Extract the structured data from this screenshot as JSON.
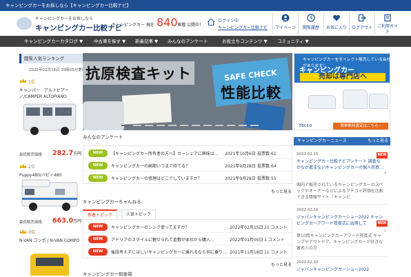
{
  "topbar": {
    "text": "キャンピングカーをお探しなら【キャンピングカー比較ナビ】"
  },
  "header": {
    "tagline": "キャンピングカーをお探しなら",
    "site_name": "キャンピングカー比較ナビ",
    "count_prefix": "キャンピングカー 現在",
    "count_number": "840",
    "count_suffix": "車種 公開中！",
    "login_line1": "ログイン中",
    "login_line2": "キャンピングカー比較ナビ",
    "buttons": [
      {
        "label": "マイページ",
        "icon": "user-icon"
      },
      {
        "label": "閲覧履歴",
        "icon": "clock-icon"
      },
      {
        "label": "お気に入り",
        "icon": "heart-icon"
      },
      {
        "label": "ログアウト",
        "icon": "logout-icon"
      },
      {
        "label": "ご利用ガイド",
        "icon": "book-icon"
      }
    ]
  },
  "nav": {
    "items": [
      "キャンピングカーカタログ ▼",
      "中古車を探す ▼",
      "新着記事 ▼",
      "みんなのアンケート",
      "お役立ちコンテンツ ▼",
      "コミュニティ ▼"
    ]
  },
  "ranking": {
    "title": "閲覧人気ランキング",
    "updated": "2022年02月18日 20時05分更新",
    "items": [
      {
        "rank": "1位",
        "name": "キャンパー　アルトピアーノ/CAMPER ALTOPIANO",
        "label_min": "最低販売価格",
        "price": "282.7",
        "unit": "万円"
      },
      {
        "rank": "2位",
        "name": "Puppy480/パピィ480",
        "label_min": "最低販売価格",
        "price": "663.0",
        "unit": "万円"
      },
      {
        "rank": "3位",
        "name": "N-VAN コンポ / N-VAN COMPO",
        "label_min": "",
        "price": "",
        "unit": ""
      }
    ]
  },
  "hero": {
    "title": "抗原検査キット",
    "subtitle": "性能比較",
    "box_text": "SAFE CHECK"
  },
  "survey": {
    "title": "みんなのアンケート",
    "rows": [
      {
        "badge": "NEW",
        "text": "【キャンピングカー所有者の方へ】カーシェアに興味は…",
        "date": "2021年10月6日",
        "votes": "投票数:61"
      },
      {
        "badge": "NEW",
        "text": "キャンピングカーの納期いつまで待てる？",
        "date": "2021年9月28日",
        "votes": "投票数:64"
      },
      {
        "badge": "NEW",
        "text": "キャンピングカーの修理はどこでしていますか？",
        "date": "2021年9月28日",
        "votes": "投票数:55"
      }
    ],
    "more": "もっと見る"
  },
  "channel": {
    "title": "キャンピングカーちゃんねる",
    "tabs": [
      "新着トピック",
      "人気トピック"
    ],
    "rows": [
      {
        "badge": "NEW",
        "text": "キャンピングカーのシンク使ってますか？",
        "date": "2022年02月15日",
        "comments": "21 コメント"
      },
      {
        "badge": "NEW",
        "text": "アドリアのスタイルに魅せられて倉敷が本社から購入…",
        "date": "2022年01月05日",
        "comments": "1 コメント"
      },
      {
        "badge": "NEW",
        "text": "後段考えずにほしいキャンピングカーに乗れるなら何に乗り…",
        "date": "2021年11月18日",
        "comments": "11 コメント"
      }
    ],
    "more": "もっと見る"
  },
  "knowledge": {
    "title": "キャンピングカー知恵袋"
  },
  "ad": {
    "line1": "キャンピングカーをダイレクト販売",
    "line1b": "している会社があります！",
    "line2": "キャンピングカー",
    "line3": "売却は専門店へ",
    "logo": "Yacco",
    "button": "簡単無料査定はこちら ›"
  },
  "news": {
    "title": "キャンピングカーニュース",
    "more": "もっと見る",
    "items": [
      {
        "date": "2022.02.15",
        "text": "キャンピングカー比較ナビアンケート 調査なかなか進まないキャンピングカーの個人売買…",
        "new": "NEW",
        "desc": "国内で販売されているキャンピングカーのスペックやオーナーなどによるクチコミ評価を比較できる情報サイト「キャンピ"
      },
      {
        "date": "2022.02.10",
        "text": "ジャパンキャンピングカーショー2022 キャンピングカーアワード授賞式に出席して",
        "new": "NEW",
        "desc": "第10回キャンピングカーアワード授賞式 キャンプやアウトドア、キャンピングカーが好きな著名人の方"
      },
      {
        "date": "2022.02.10",
        "text": "ジャパンキャンピングカーショー2022",
        "new": "",
        "desc": ""
      }
    ]
  },
  "colors": {
    "brand": "#1f4e92",
    "accent": "#d63a20",
    "new_green": "#9cc21d",
    "new_red": "#e83a1f",
    "nav": "#404040"
  }
}
